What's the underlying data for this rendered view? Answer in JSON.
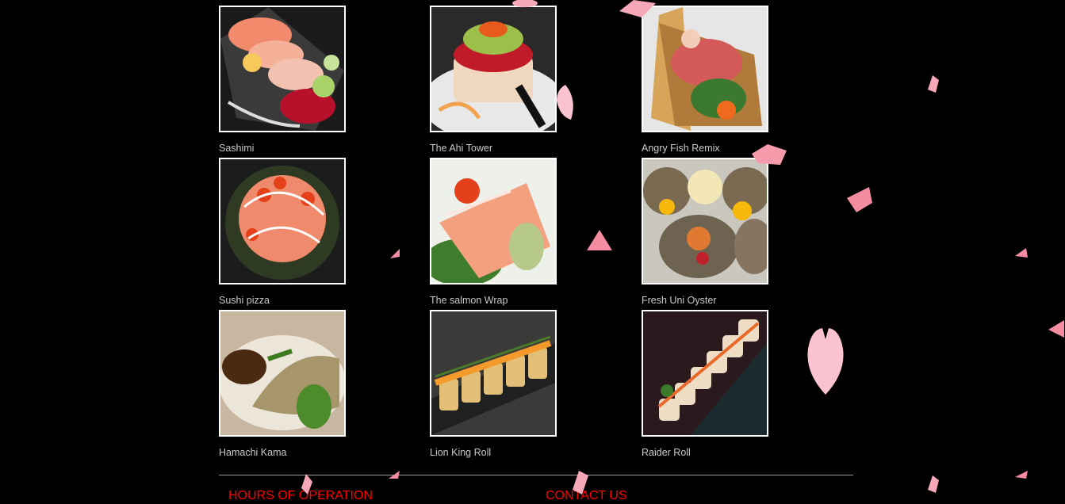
{
  "gallery": {
    "items": [
      {
        "caption": "Sashimi"
      },
      {
        "caption": "The Ahi Tower"
      },
      {
        "caption": "Angry Fish Remix"
      },
      {
        "caption": "Sushi pizza"
      },
      {
        "caption": "The salmon Wrap"
      },
      {
        "caption": "Fresh Uni Oyster"
      },
      {
        "caption": "Hamachi Kama"
      },
      {
        "caption": "Lion King Roll"
      },
      {
        "caption": "Raider Roll"
      }
    ]
  },
  "footer": {
    "hours_label": "HOURS OF OPERATION",
    "contact_label": "CONTACT US"
  },
  "colors": {
    "background": "#000000",
    "caption": "#c8c8c8",
    "footer_link": "#ff0000",
    "petal": "#f7a8b8",
    "border": "#ffffff"
  }
}
